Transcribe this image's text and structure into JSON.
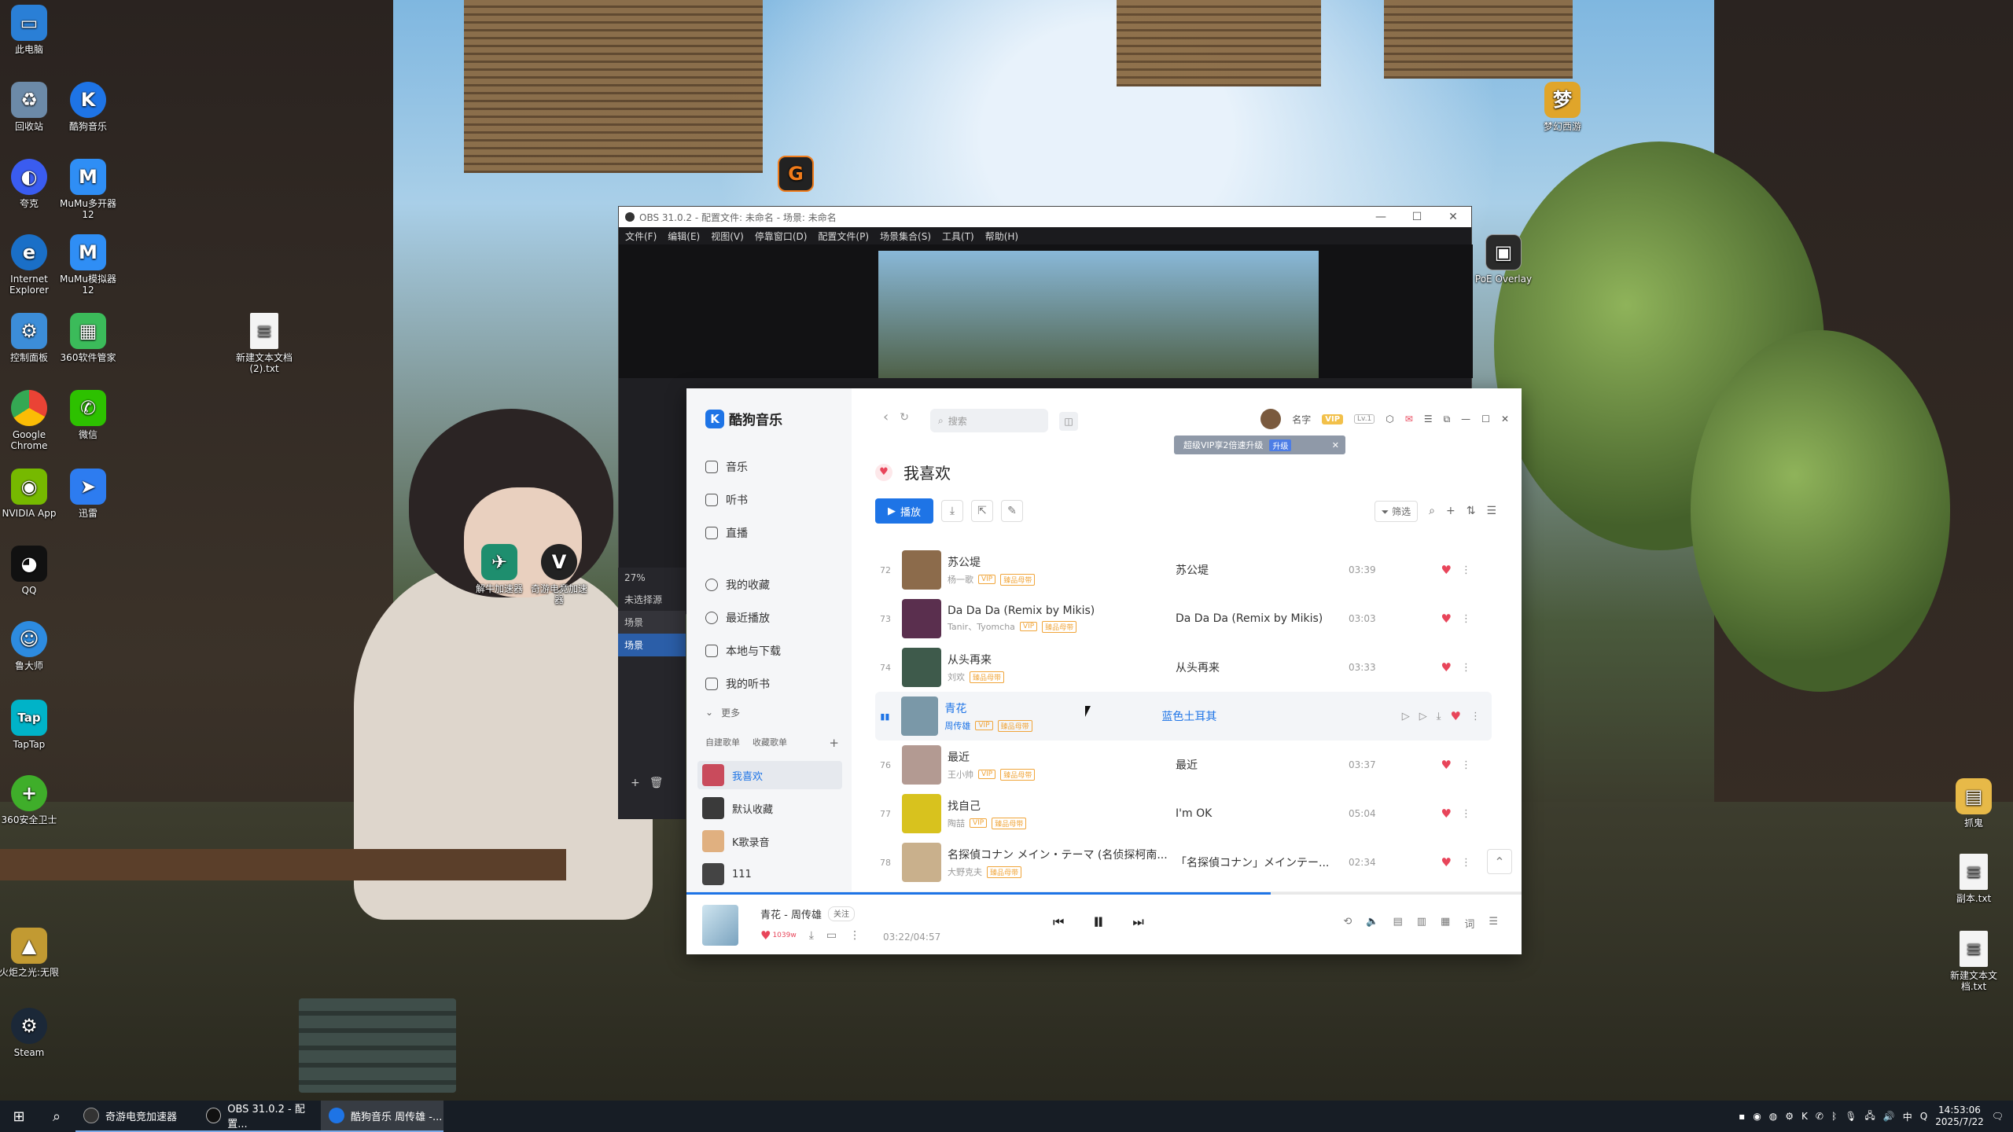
{
  "desktop_icons": [
    {
      "label": "此电脑"
    },
    {
      "label": "回收站"
    },
    {
      "label": "酷狗音乐"
    },
    {
      "label": "夸克"
    },
    {
      "label": "MuMu多开器12"
    },
    {
      "label": "Internet Explorer"
    },
    {
      "label": "MuMu模拟器12"
    },
    {
      "label": "控制面板"
    },
    {
      "label": "360软件管家"
    },
    {
      "label": "新建文本文档 (2).txt"
    },
    {
      "label": "Google Chrome"
    },
    {
      "label": "微信"
    },
    {
      "label": "NVIDIA App"
    },
    {
      "label": "迅雷"
    },
    {
      "label": "QQ"
    },
    {
      "label": "鲁大师"
    },
    {
      "label": "TapTap"
    },
    {
      "label": "360安全卫士"
    },
    {
      "label": "火炬之光:无限"
    },
    {
      "label": "Steam"
    },
    {
      "label": "梦幻西游"
    },
    {
      "label": "PoE Overlay"
    },
    {
      "label": "解牛加速器"
    },
    {
      "label": "奇游电竞加速器"
    },
    {
      "label": "抓鬼"
    },
    {
      "label": "副本.txt"
    },
    {
      "label": "新建文本文档.txt"
    }
  ],
  "obs": {
    "title": "OBS 31.0.2 - 配置文件: 未命名 - 场景: 未命名",
    "menu": [
      "文件(F)",
      "编辑(E)",
      "视图(V)",
      "停靠窗口(D)",
      "配置文件(P)",
      "场景集合(S)",
      "工具(T)",
      "帮助(H)"
    ],
    "panel": {
      "status": "27%",
      "no_source": "未选择源",
      "header": "场景",
      "scene": "场景"
    }
  },
  "kugou": {
    "app_name": "酷狗音乐",
    "search_placeholder": "搜索",
    "user_name": "名字",
    "vip_badge": "VIP",
    "level": "Lv.1",
    "tip_text": "超级VIP享2倍速升级",
    "tip_action": "升级",
    "nav": [
      {
        "label": "音乐"
      },
      {
        "label": "听书"
      },
      {
        "label": "直播"
      },
      {
        "label": "我的收藏"
      },
      {
        "label": "最近播放"
      },
      {
        "label": "本地与下载"
      },
      {
        "label": "我的听书"
      },
      {
        "label": "更多"
      }
    ],
    "playlist_tabs": {
      "created": "自建歌单",
      "collected": "收藏歌单"
    },
    "playlists": [
      {
        "label": "我喜欢",
        "selected": true
      },
      {
        "label": "默认收藏"
      },
      {
        "label": "K歌录音"
      },
      {
        "label": "111"
      }
    ],
    "page_title": "我喜欢",
    "toolbar": {
      "play_label": "播放",
      "filter_label": "筛选"
    },
    "songs": [
      {
        "no": "72",
        "title": "苏公堤",
        "artist": "杨一歌",
        "album": "苏公堤",
        "duration": "03:39",
        "cover": "#8c6b4b"
      },
      {
        "no": "73",
        "title": "Da Da Da (Remix by Mikis)",
        "artist": "Tanir、Tyomcha",
        "album": "Da Da Da (Remix by Mikis)",
        "duration": "03:03",
        "cover": "#5a2f4e"
      },
      {
        "no": "74",
        "title": "从头再来",
        "artist": "刘欢",
        "album": "从头再来",
        "duration": "03:33",
        "cover": "#3e5a4b"
      },
      {
        "no": "",
        "title": "青花",
        "artist": "周传雄",
        "album": "蓝色土耳其",
        "duration": "",
        "cover": "#7a98a8",
        "active": true
      },
      {
        "no": "76",
        "title": "最近",
        "artist": "王小帅",
        "album": "最近",
        "duration": "03:37",
        "cover": "#b39a92"
      },
      {
        "no": "77",
        "title": "找自己",
        "artist": "陶喆",
        "album": "I'm OK",
        "duration": "05:04",
        "cover": "#d8c21e"
      },
      {
        "no": "78",
        "title": "名探偵コナン メイン・テーマ (名侦探柯南...",
        "artist": "大野克夫",
        "album": "「名探偵コナン」メインテー...",
        "duration": "02:34",
        "cover": "#c9b08c"
      }
    ],
    "tags": {
      "vip": "VIP",
      "hq": "臻品母带"
    },
    "player": {
      "now_playing": "青花 - 周传雄",
      "follow": "关注",
      "like_count": "1039w",
      "time": "03:22/04:57",
      "progress": 0.7,
      "lyrics_btn": "词"
    }
  },
  "taskbar": {
    "tasks": [
      {
        "label": "奇游电竞加速器"
      },
      {
        "label": "OBS 31.0.2 - 配置..."
      },
      {
        "label": "酷狗音乐 周传雄 -..."
      }
    ],
    "ime": "中",
    "time": "14:53:06",
    "date": "2025/7/22"
  },
  "colors": {
    "accent": "#1e74e6",
    "heart": "#e8455a"
  }
}
